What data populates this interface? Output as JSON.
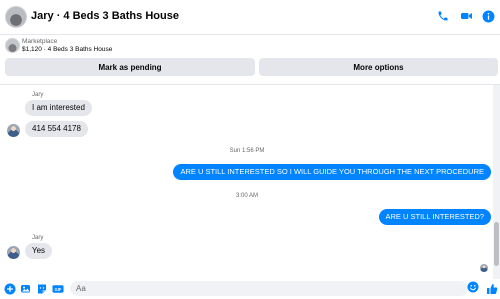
{
  "header": {
    "title": "Jary · 4 Beds 3 Baths House",
    "icons": [
      "phone-icon",
      "video-icon",
      "info-icon"
    ]
  },
  "marketplace": {
    "source": "Marketplace",
    "listing": "$1,120 · 4 Beds 3 Baths House",
    "mark_pending_label": "Mark as pending",
    "more_options_label": "More options"
  },
  "messages": [
    {
      "sender": "Jary",
      "text": "I am interested"
    },
    {
      "text": "414 554 4178"
    },
    {
      "timestamp": "Sun 1:56 PM"
    },
    {
      "text": "ARE U STILL INTERESTED SO I WILL GUIDE YOU THROUGH THE NEXT PROCEDURE"
    },
    {
      "timestamp": "3:00 AM"
    },
    {
      "text": "ARE U STILL INTERESTED?"
    },
    {
      "sender": "Jary",
      "text": "Yes"
    }
  ],
  "composer": {
    "placeholder": "Aa",
    "icons": [
      "add-icon",
      "photo-icon",
      "sticker-icon",
      "gif-icon",
      "emoji-icon",
      "like-icon"
    ]
  },
  "colors": {
    "accent": "#0084ff",
    "incoming_bubble": "#e4e6eb",
    "muted_text": "#65676b"
  }
}
